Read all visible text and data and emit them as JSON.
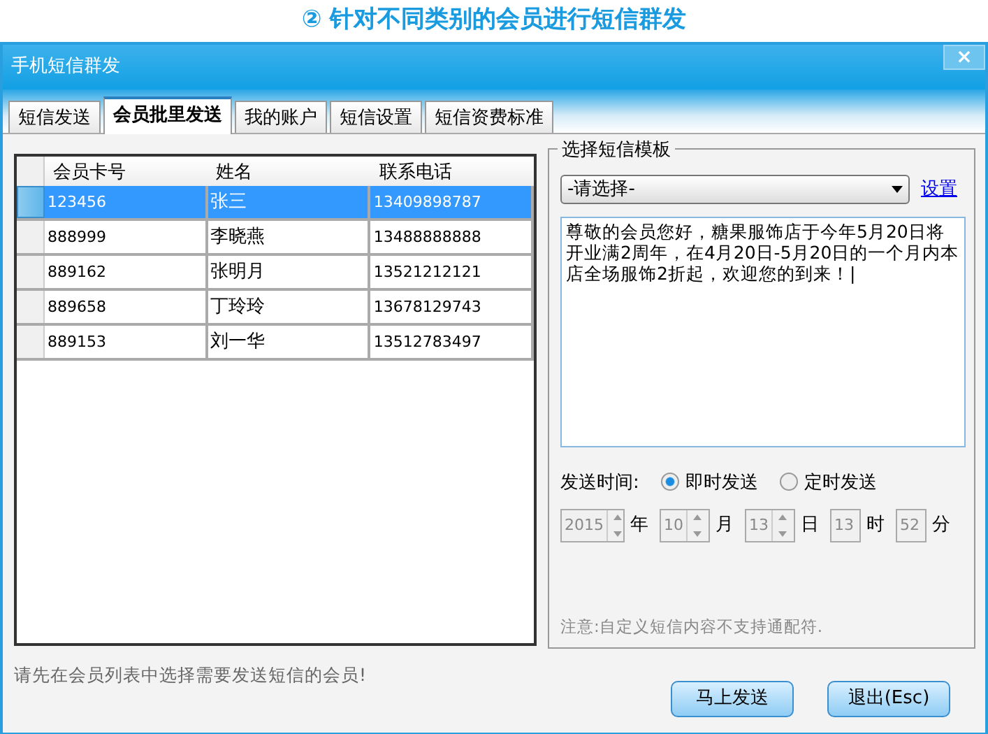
{
  "heading": "② 针对不同类别的会员进行短信群发",
  "window": {
    "title": "手机短信群发",
    "close": "×"
  },
  "tabs": [
    {
      "label": "短信发送",
      "selected": false
    },
    {
      "label": "会员批里发送",
      "selected": true
    },
    {
      "label": "我的账户",
      "selected": false
    },
    {
      "label": "短信设置",
      "selected": false
    },
    {
      "label": "短信资费标准",
      "selected": false
    }
  ],
  "table": {
    "columns": [
      "会员卡号",
      "姓名",
      "联系电话"
    ],
    "rows": [
      {
        "cells": [
          "123456",
          "张三",
          "13409898787"
        ],
        "selected": true
      },
      {
        "cells": [
          "888999",
          "李晓燕",
          "13488888888"
        ],
        "selected": false
      },
      {
        "cells": [
          "889162",
          "张明月",
          "13521212121"
        ],
        "selected": false
      },
      {
        "cells": [
          "889658",
          "丁玲玲",
          "13678129743"
        ],
        "selected": false
      },
      {
        "cells": [
          "889153",
          "刘一华",
          "13512783497"
        ],
        "selected": false
      }
    ]
  },
  "template": {
    "legend": "选择短信模板",
    "select": "-请选择-",
    "settings_link": "设置",
    "message": "尊敬的会员您好，糖果服饰店于今年5月20日将开业满2周年，在4月20日-5月20日的一个月内本店全场服饰2折起，欢迎您的到来！|",
    "send_time_label": "发送时间:",
    "options": [
      {
        "label": "即时发送",
        "selected": true
      },
      {
        "label": "定时发送",
        "selected": false
      }
    ],
    "datetime": [
      {
        "value": "2015",
        "unit": "年",
        "kind": "spin",
        "disabled": true
      },
      {
        "value": "10",
        "unit": "月",
        "kind": "spin",
        "disabled": true
      },
      {
        "value": "13",
        "unit": "日",
        "kind": "spin",
        "disabled": true
      },
      {
        "value": "13",
        "unit": "时",
        "kind": "box",
        "disabled": true
      },
      {
        "value": "52",
        "unit": "分",
        "kind": "box",
        "disabled": true
      }
    ],
    "note": "注意:自定义短信内容不支持通配符."
  },
  "status": "请先在会员列表中选择需要发送短信的会员!",
  "buttons": [
    "马上发送",
    "退出(Esc)"
  ]
}
